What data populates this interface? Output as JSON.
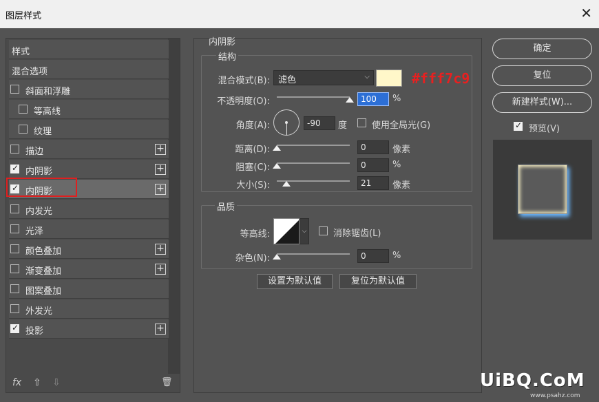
{
  "dialog": {
    "title": "图层样式"
  },
  "left_panel": {
    "items": [
      {
        "label": "样式",
        "checkbox": false,
        "checked": false,
        "plus": false,
        "selected": false
      },
      {
        "label": "混合选项",
        "checkbox": false,
        "checked": false,
        "plus": false,
        "selected": false
      },
      {
        "label": "斜面和浮雕",
        "checkbox": true,
        "checked": false,
        "plus": false,
        "selected": false
      },
      {
        "label": "等高线",
        "checkbox": true,
        "checked": false,
        "plus": false,
        "selected": false,
        "indent": true
      },
      {
        "label": "纹理",
        "checkbox": true,
        "checked": false,
        "plus": false,
        "selected": false,
        "indent": true
      },
      {
        "label": "描边",
        "checkbox": true,
        "checked": false,
        "plus": true,
        "selected": false
      },
      {
        "label": "内阴影",
        "checkbox": true,
        "checked": true,
        "plus": true,
        "selected": false
      },
      {
        "label": "内阴影",
        "checkbox": true,
        "checked": true,
        "plus": true,
        "selected": true
      },
      {
        "label": "内发光",
        "checkbox": true,
        "checked": false,
        "plus": false,
        "selected": false
      },
      {
        "label": "光泽",
        "checkbox": true,
        "checked": false,
        "plus": false,
        "selected": false
      },
      {
        "label": "颜色叠加",
        "checkbox": true,
        "checked": false,
        "plus": true,
        "selected": false
      },
      {
        "label": "渐变叠加",
        "checkbox": true,
        "checked": false,
        "plus": true,
        "selected": false
      },
      {
        "label": "图案叠加",
        "checkbox": true,
        "checked": false,
        "plus": false,
        "selected": false
      },
      {
        "label": "外发光",
        "checkbox": true,
        "checked": false,
        "plus": false,
        "selected": false
      },
      {
        "label": "投影",
        "checkbox": true,
        "checked": true,
        "plus": true,
        "selected": false
      }
    ],
    "plus_glyph": "+",
    "footer": {
      "fx": "fx",
      "up": "⇧",
      "down": "⇩",
      "trash": "🗑"
    }
  },
  "inner_shadow": {
    "title": "内阴影",
    "structure": {
      "title": "结构",
      "blend_mode_label": "混合模式(B):",
      "blend_mode_value": "滤色",
      "color": "#fff7c9",
      "color_note": "#fff7c9",
      "opacity_label": "不透明度(O):",
      "opacity_value": "100",
      "opacity_unit": "%",
      "angle_label": "角度(A):",
      "angle_value": "-90",
      "angle_unit": "度",
      "global_light_label": "使用全局光(G)",
      "global_light_checked": false,
      "distance_label": "距离(D):",
      "distance_value": "0",
      "distance_unit": "像素",
      "choke_label": "阻塞(C):",
      "choke_value": "0",
      "choke_unit": "%",
      "size_label": "大小(S):",
      "size_value": "21",
      "size_unit": "像素"
    },
    "quality": {
      "title": "品质",
      "contour_label": "等高线:",
      "antialias_label": "消除锯齿(L)",
      "antialias_checked": false,
      "noise_label": "杂色(N):",
      "noise_value": "0",
      "noise_unit": "%"
    },
    "buttons": {
      "make_default": "设置为默认值",
      "reset_default": "复位为默认值"
    }
  },
  "right_panel": {
    "ok": "确定",
    "reset": "复位",
    "new_style": "新建样式(W)...",
    "preview_label": "预览(V)",
    "preview_checked": true
  },
  "watermark": {
    "main": "UiBQ.CoM",
    "sub": "www.psahz.com"
  }
}
